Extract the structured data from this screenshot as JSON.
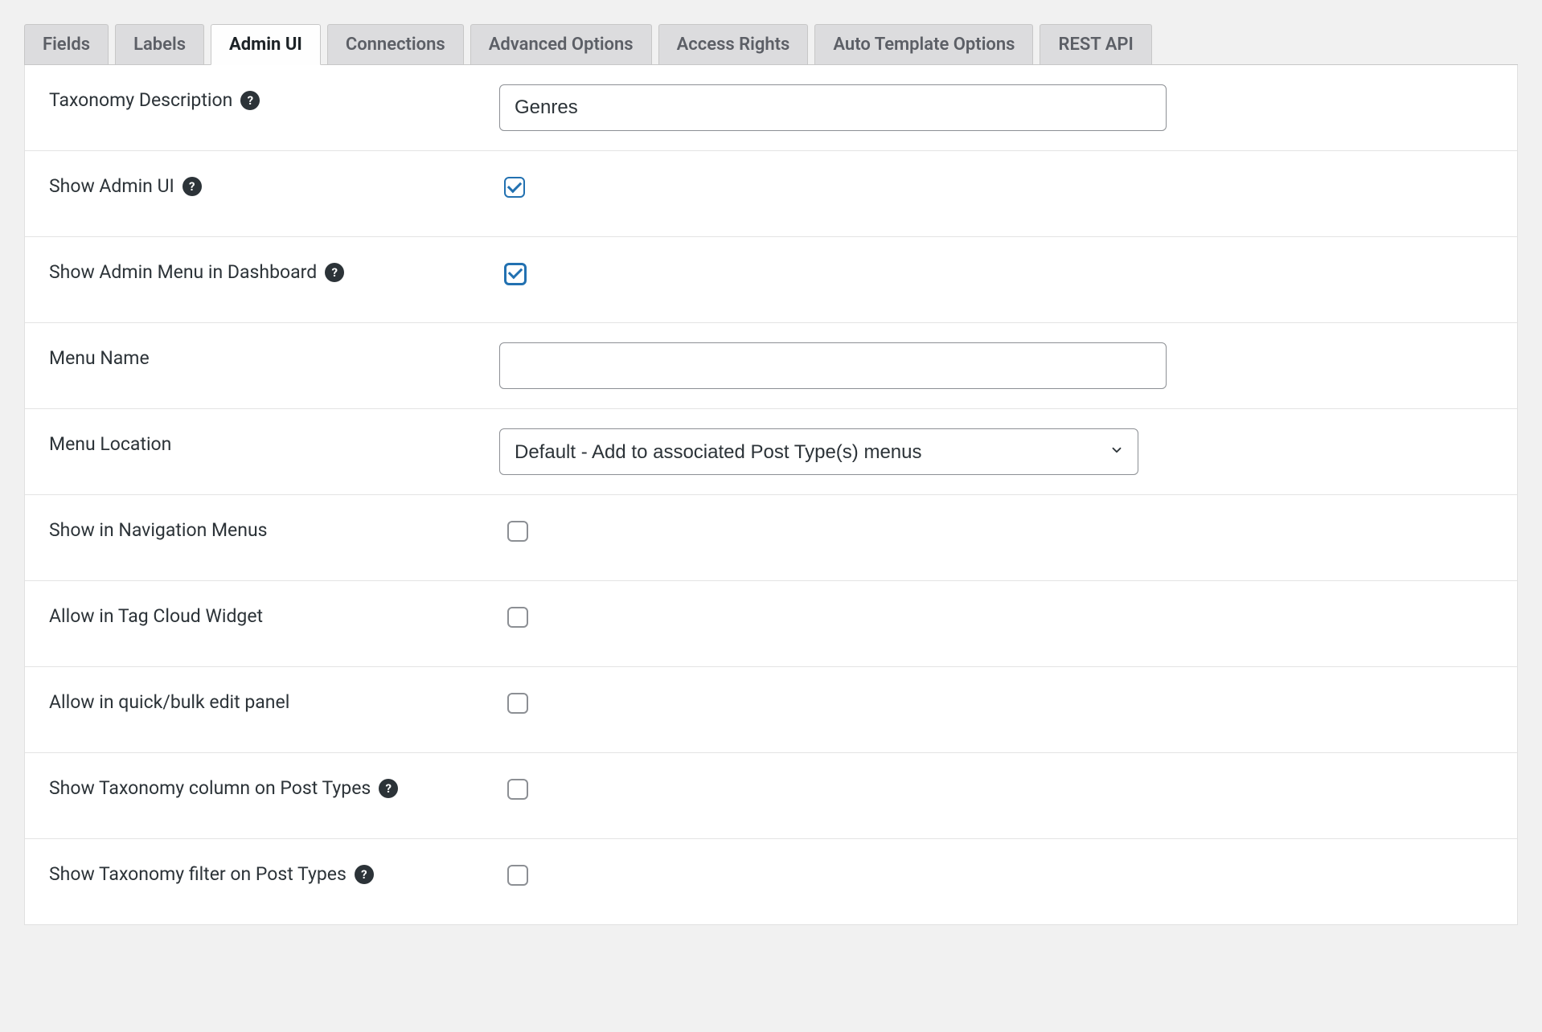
{
  "tabs": [
    {
      "label": "Fields",
      "active": false
    },
    {
      "label": "Labels",
      "active": false
    },
    {
      "label": "Admin UI",
      "active": true
    },
    {
      "label": "Connections",
      "active": false
    },
    {
      "label": "Advanced Options",
      "active": false
    },
    {
      "label": "Access Rights",
      "active": false
    },
    {
      "label": "Auto Template Options",
      "active": false
    },
    {
      "label": "REST API",
      "active": false
    }
  ],
  "form": {
    "taxonomy_description": {
      "label": "Taxonomy Description",
      "value": "Genres",
      "help": true
    },
    "show_admin_ui": {
      "label": "Show Admin UI",
      "checked": true,
      "help": true
    },
    "show_admin_menu_dashboard": {
      "label": "Show Admin Menu in Dashboard",
      "checked": true,
      "help": true
    },
    "menu_name": {
      "label": "Menu Name",
      "value": ""
    },
    "menu_location": {
      "label": "Menu Location",
      "selected": "Default - Add to associated Post Type(s) menus"
    },
    "show_nav_menus": {
      "label": "Show in Navigation Menus",
      "checked": false
    },
    "allow_tag_cloud": {
      "label": "Allow in Tag Cloud Widget",
      "checked": false
    },
    "allow_quick_bulk": {
      "label": "Allow in quick/bulk edit panel",
      "checked": false
    },
    "show_tax_column": {
      "label": "Show Taxonomy column on Post Types",
      "checked": false,
      "help": true
    },
    "show_tax_filter": {
      "label": "Show Taxonomy filter on Post Types",
      "checked": false,
      "help": true
    }
  }
}
